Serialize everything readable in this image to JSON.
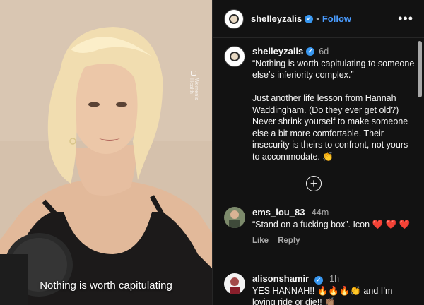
{
  "media": {
    "caption": "Nothing is worth capitulating",
    "watermark": "Women's Health"
  },
  "post": {
    "author": "shelleyzalis",
    "follow_label": "Follow",
    "dot": "•",
    "more_icon": "more-options-icon",
    "caption": {
      "username": "shelleyzalis",
      "time": "6d",
      "text": "“Nothing is worth capitulating to someone else’s inferiority complex.”\n\nJust another life lesson from Hannah Waddingham. (Do they ever get old?) Never shrink yourself to make someone else a bit more comfortable. Their insecurity is theirs to confront, not yours to accommodate. 👏"
    },
    "load_more_icon": "plus-circle-icon"
  },
  "comments": [
    {
      "username": "ems_lou_83",
      "time": "44m",
      "text": "“Stand on a fucking box”. Icon ❤️ ❤️ ❤️",
      "like_label": "Like",
      "reply_label": "Reply"
    },
    {
      "username": "alisonshamir",
      "time": "1h",
      "verified": true,
      "text": "YES HANNAH!! 🔥🔥🔥👏 and I’m loving ride or die!! 👏🏽"
    }
  ],
  "colors": {
    "link_blue": "#4a9cff",
    "verified_blue": "#3897f0",
    "panel_bg": "#121212"
  }
}
